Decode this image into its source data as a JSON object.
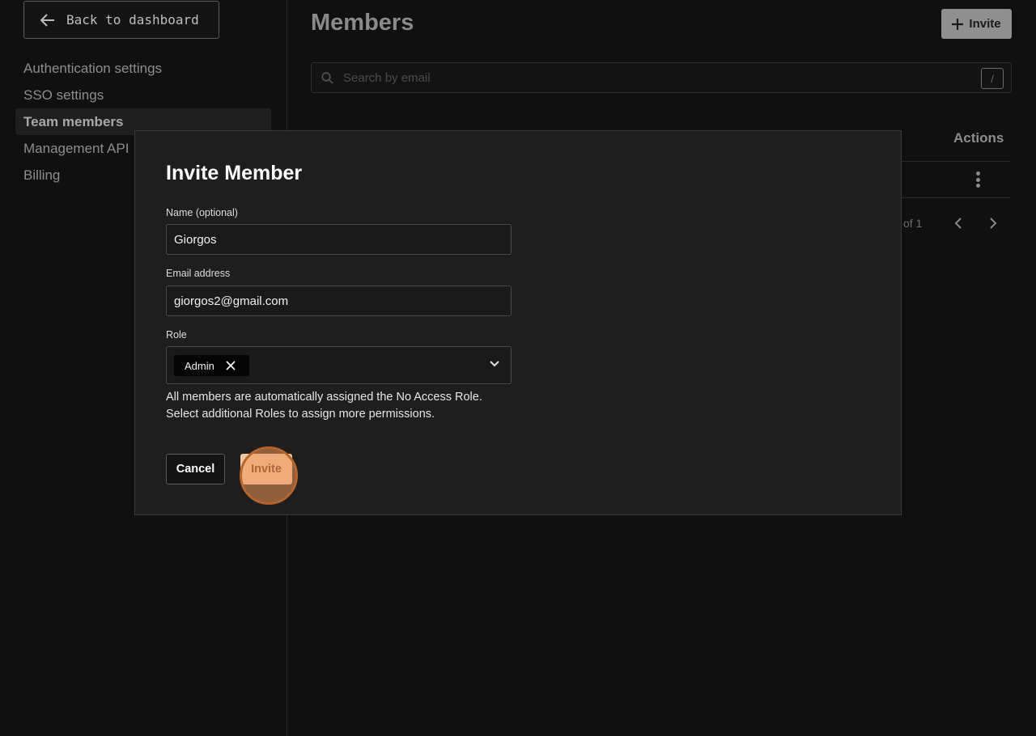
{
  "sidebar": {
    "back_label": "Back to dashboard",
    "items": [
      {
        "label": "Authentication settings",
        "active": false
      },
      {
        "label": "SSO settings",
        "active": false
      },
      {
        "label": "Team members",
        "active": true
      },
      {
        "label": "Management API",
        "active": false
      },
      {
        "label": "Billing",
        "active": false
      }
    ]
  },
  "main": {
    "title": "Members",
    "invite_label": "Invite",
    "search_placeholder": "Search by email",
    "search_shortcut": "/",
    "actions_header": "Actions",
    "pager_text": "of 1"
  },
  "modal": {
    "title": "Invite Member",
    "name_label": "Name (optional)",
    "name_value": "Giorgos",
    "email_label": "Email address",
    "email_value": "giorgos2@gmail.com",
    "role_label": "Role",
    "role_chip": "Admin",
    "help_line1": "All members are automatically assigned the No Access Role.",
    "help_line2": "Select additional Roles to assign more permissions.",
    "cancel_label": "Cancel",
    "invite_label": "Invite"
  },
  "icons": {
    "back": "arrow-left-icon",
    "plus": "plus-icon",
    "search": "search-icon",
    "kebab": "more-vertical-icon",
    "prev": "chevron-left-icon",
    "next": "chevron-right-icon",
    "remove": "close-icon",
    "dropdown": "chevron-down-icon"
  },
  "colors": {
    "accent_invite": "#f2c7a4",
    "click_indicator": "#b8652a"
  }
}
